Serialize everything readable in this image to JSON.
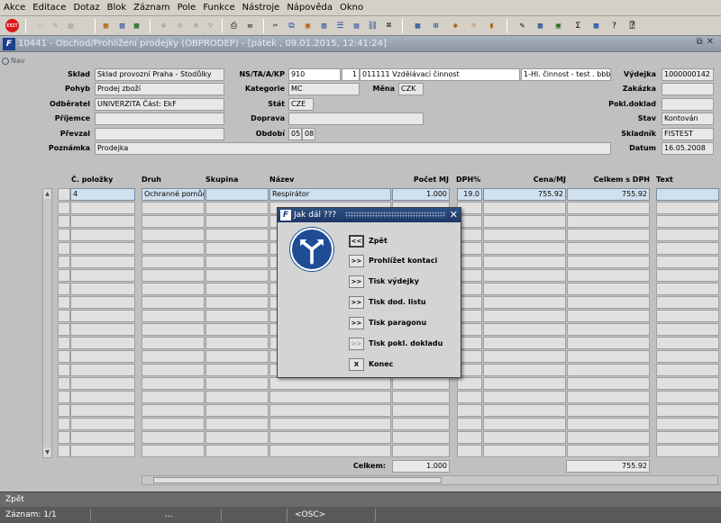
{
  "menu": [
    "Akce",
    "Editace",
    "Dotaz",
    "Blok",
    "Záznam",
    "Pole",
    "Funkce",
    "Nástroje",
    "Nápověda",
    "Okno"
  ],
  "toolbar": {
    "exit_label": "EXIT"
  },
  "window": {
    "title": "10441 - Obchod/Prohlížení prodejky (OBPRODEP) - [pátek , 09.01.2015, 12:41:24]"
  },
  "nav": {
    "label": "Nav"
  },
  "form": {
    "sklad_label": "Sklad",
    "sklad": "Sklad provozní Praha - Stodůlky",
    "pohyb_label": "Pohyb",
    "pohyb": "Prodej zboží",
    "odberatel_label": "Odběratel",
    "odberatel": "UNIVERZITA Část: EkF",
    "prijemce_label": "Příjemce",
    "prijemce": "",
    "prevzal_label": "Převzal",
    "prevzal": "",
    "poznamka_label": "Poznámka",
    "poznamka": "Prodejka",
    "ns_label": "NS/TA/A/KP",
    "ns1": "910",
    "ns2": "1",
    "ns3": "011111 Vzdělávací činnost",
    "ns4": "1-Hl. činnost - test . bbbb",
    "kategorie_label": "Kategorie",
    "kategorie": "MC",
    "mena_label": "Měna",
    "mena": "CZK",
    "stat_label": "Stát",
    "stat": "CZE",
    "doprava_label": "Doprava",
    "doprava": "",
    "obdobi_label": "Období",
    "obdobi_m": "05",
    "obdobi_r": "08",
    "vydejka_label": "Výdejka",
    "vydejka": "1000000142",
    "zakazka_label": "Zakázka",
    "zakazka": "",
    "pokl_label": "Pokl.doklad",
    "pokl": "",
    "stav_label": "Stav",
    "stav": "Kontován",
    "skladnik_label": "Skladník",
    "skladnik": "FISTEST",
    "datum_label": "Datum",
    "datum": "16.05.2008"
  },
  "grid": {
    "headers": {
      "c_polozky": "Č. položky",
      "druh": "Druh",
      "skupina": "Skupina",
      "nazev": "Název",
      "pocet": "Počet MJ",
      "dph": "DPH%",
      "cena": "Cena/MJ",
      "celkem": "Celkem s DPH",
      "text": "Text"
    },
    "row1": {
      "c_polozky": "4",
      "druh": "Ochranné pomůcky",
      "skupina": "",
      "nazev": "Respirátor",
      "pocet": "1.000",
      "dph": "19.0",
      "cena": "755.92",
      "celkem": "755.92",
      "text": ""
    },
    "total_label": "Celkem:",
    "total_pocet": "1.000",
    "total_celkem": "755.92"
  },
  "dialog": {
    "title": "Jak dál ???",
    "items": [
      {
        "btn": "<<",
        "label": "Zpět"
      },
      {
        "btn": ">>",
        "label": "Prohlížet kontaci"
      },
      {
        "btn": ">>",
        "label": "Tisk výdejky"
      },
      {
        "btn": ">>",
        "label": "Tisk dod. listu"
      },
      {
        "btn": ">>",
        "label": "Tisk paragonu"
      },
      {
        "btn": ">>",
        "label": "Tisk pokl. dokladu"
      },
      {
        "btn": "X",
        "label": "Konec"
      }
    ]
  },
  "status": {
    "message": "Zpět",
    "record": "Záznam: 1/1",
    "dots": "...",
    "osc": "<OSC>"
  }
}
